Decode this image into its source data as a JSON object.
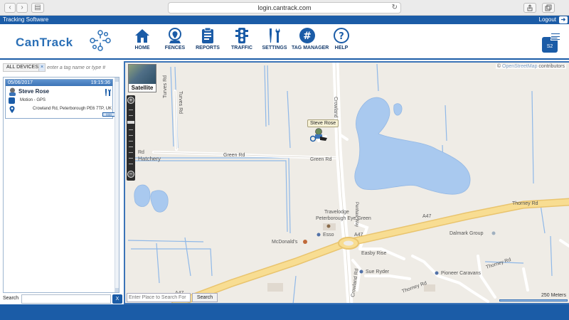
{
  "browser": {
    "url": "login.cantrack.com",
    "back_icon": "chevron-left-icon",
    "forward_icon": "chevron-right-icon"
  },
  "app_strip": {
    "title": "Tracking Software",
    "logout": "Logout"
  },
  "header": {
    "logo_text": "CanTrack",
    "nav": [
      {
        "id": "home",
        "label": "HOME",
        "icon": "home-icon"
      },
      {
        "id": "fences",
        "label": "FENCES",
        "icon": "map-pin-icon"
      },
      {
        "id": "reports",
        "label": "REPORTS",
        "icon": "clipboard-icon"
      },
      {
        "id": "traffic",
        "label": "TRAFFIC",
        "icon": "traffic-light-icon"
      },
      {
        "id": "settings",
        "label": "SETTINGS",
        "icon": "tools-icon"
      },
      {
        "id": "tag_manager",
        "label": "TAG MANAGER",
        "icon": "hashtag-icon"
      },
      {
        "id": "help",
        "label": "HELP",
        "icon": "question-icon"
      }
    ],
    "user_badge": "S2"
  },
  "left_panel": {
    "tag_filter": "ALL DEVICES",
    "tag_remove": "×",
    "tag_placeholder": "enter a tag name or type #",
    "device": {
      "date": "05/06/2017",
      "time": "19:15:36",
      "name": "Steve Rose",
      "motion": "Motion - GPS",
      "address": "Crowland Rd, Peterborough PE6 7TP, UK",
      "battery": "|||||||"
    },
    "search_label": "Search",
    "search_value": "",
    "search_button_icon": "excel-icon"
  },
  "map": {
    "satellite_label": "Satellite",
    "attribution_copy": "©",
    "attribution_osm": "OpenStreetMap",
    "attribution_rest": "contributors",
    "vehicle_label": "Steve Rose",
    "place_placeholder": "Enter Place to Search For",
    "place_button": "Search",
    "scale_text": "250 Meters",
    "labels": {
      "turves_rd_1": "Turves Rd",
      "turves_rd_2": "Turves Rd",
      "rd_fragment": "Rd",
      "hatchery": "Hatchery",
      "green_rd_1": "Green Rd",
      "green_rd_2": "Green Rd",
      "crowland_rd_1": "Crowland Rd",
      "crowland_rd_2": "Crowland Rd",
      "penhaw_way": "Penhaw Way",
      "a47_1": "A47",
      "a47_2": "A47",
      "a47_3": "A47",
      "thorney_rd_1": "Thorney Rd",
      "thorney_rd_2": "Thorney Rd",
      "thorney_rd_3": "Thorney Rd",
      "travelodge_1": "Travelodge",
      "travelodge_2": "Peterborough Eye Green",
      "mcdonalds": "McDonald's",
      "esso": "Esso",
      "dalmark": "Dalmark Group",
      "easby_rise": "Easby Rise",
      "sue_ryder": "Sue Ryder",
      "pioneer": "Pioneer Caravans"
    }
  },
  "colors": {
    "brand": "#1b5ca7",
    "water": "#a9c9ef",
    "road_major": "#f5d88a",
    "land": "#efece6"
  }
}
